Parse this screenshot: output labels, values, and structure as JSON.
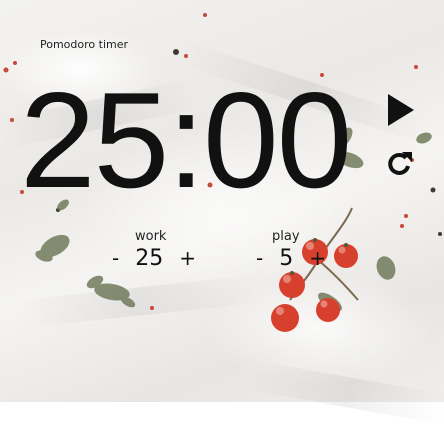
{
  "app": {
    "title": "Pomodoro timer"
  },
  "timer": {
    "display": "25:00"
  },
  "controls": {
    "play_icon": "play-icon",
    "reset_icon": "reset-icon"
  },
  "work": {
    "label": "work",
    "minus": "-",
    "value": "25",
    "plus": "+"
  },
  "play": {
    "label": "play",
    "minus": "-",
    "value": "5",
    "plus": "+"
  },
  "colors": {
    "text": "#111111",
    "tomato": "#d8402e",
    "herb": "#6f7a5a"
  }
}
